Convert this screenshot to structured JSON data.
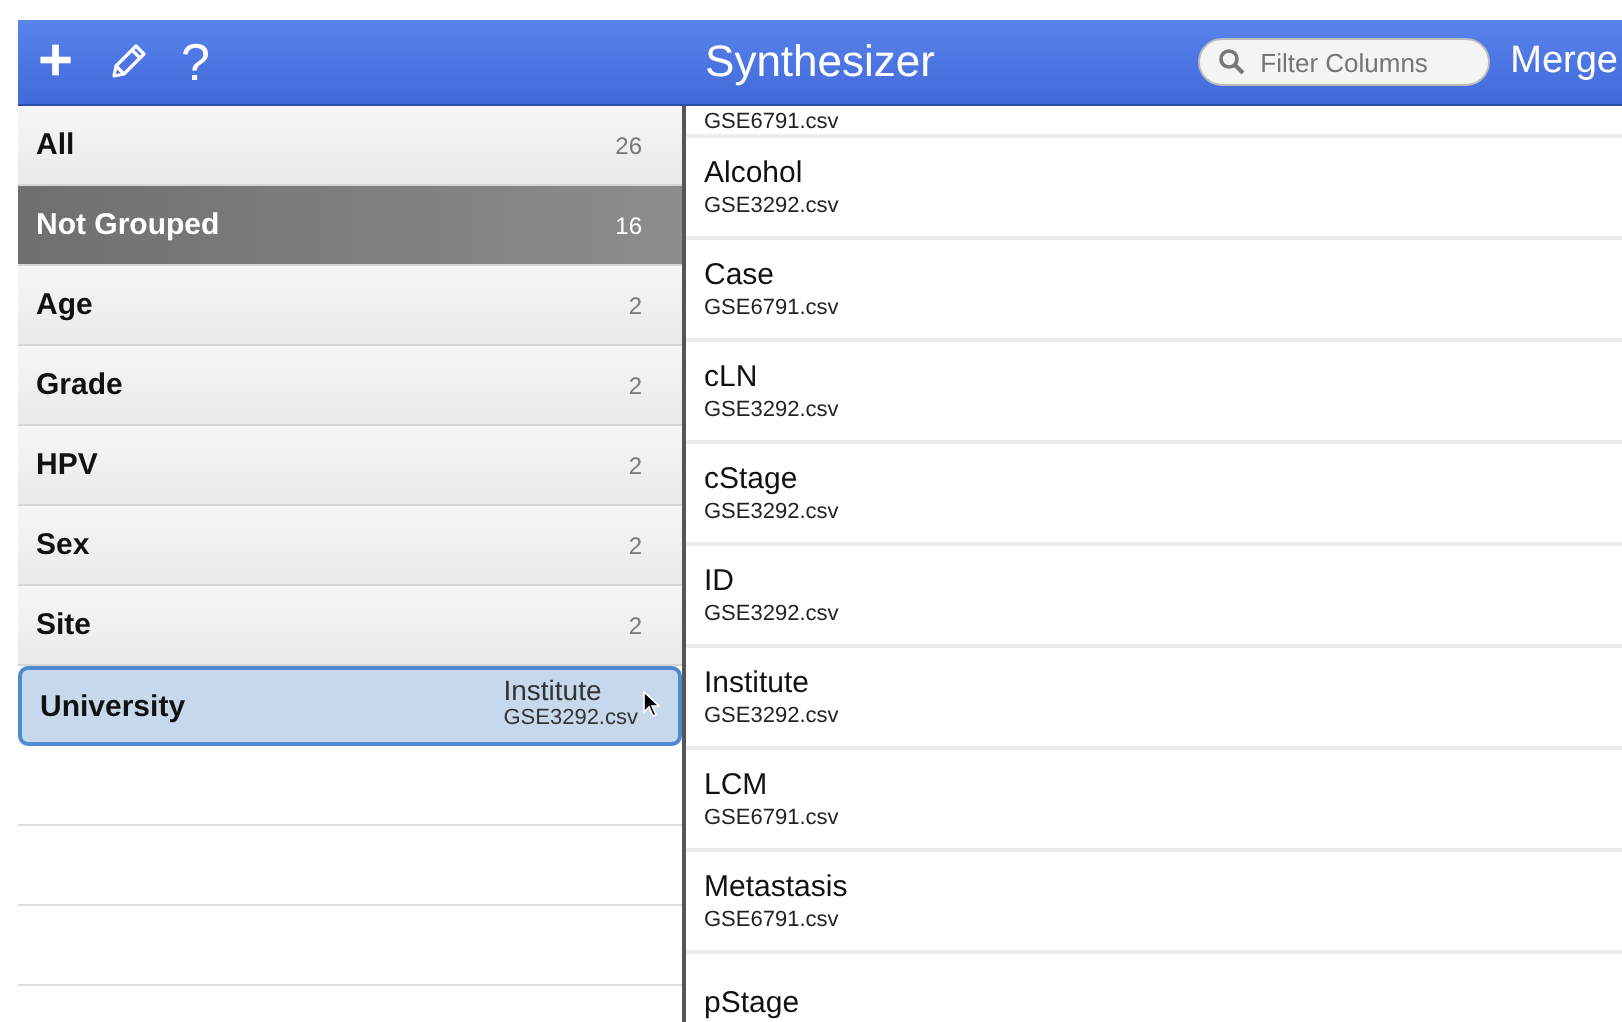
{
  "toolbar": {
    "add": "+",
    "help": "?",
    "title": "Synthesizer",
    "search": {
      "placeholder": "Filter Columns"
    },
    "merge": "Merge"
  },
  "groups": [
    {
      "label": "All",
      "count": "26",
      "selected": false,
      "drop_target": false
    },
    {
      "label": "Not Grouped",
      "count": "16",
      "selected": true,
      "drop_target": false
    },
    {
      "label": "Age",
      "count": "2",
      "selected": false,
      "drop_target": false
    },
    {
      "label": "Grade",
      "count": "2",
      "selected": false,
      "drop_target": false
    },
    {
      "label": "HPV",
      "count": "2",
      "selected": false,
      "drop_target": false
    },
    {
      "label": "Sex",
      "count": "2",
      "selected": false,
      "drop_target": false
    },
    {
      "label": "Site",
      "count": "2",
      "selected": false,
      "drop_target": false
    },
    {
      "label": "University",
      "selected": false,
      "drop_target": true
    }
  ],
  "drag_item": {
    "name": "Institute",
    "file": "GSE3292.csv"
  },
  "columns": [
    {
      "file": "GSE6791.csv"
    },
    {
      "name": "Alcohol",
      "file": "GSE3292.csv"
    },
    {
      "name": "Case",
      "file": "GSE6791.csv"
    },
    {
      "name": "cLN",
      "file": "GSE3292.csv"
    },
    {
      "name": "cStage",
      "file": "GSE3292.csv"
    },
    {
      "name": "ID",
      "file": "GSE3292.csv"
    },
    {
      "name": "Institute",
      "file": "GSE3292.csv"
    },
    {
      "name": "LCM",
      "file": "GSE6791.csv"
    },
    {
      "name": "Metastasis",
      "file": "GSE6791.csv"
    },
    {
      "name": "pStage"
    }
  ]
}
